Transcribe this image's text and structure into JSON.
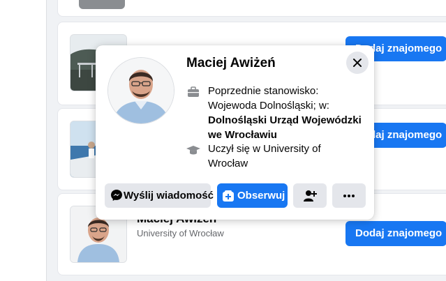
{
  "list": {
    "add_label": "Dodaj znajomego",
    "items": [
      {
        "add_label": "Dodaj znajomego"
      },
      {
        "add_label": "Dodaj znajomego"
      },
      {
        "name": "Maciej Awiżeń",
        "subtitle": "University of Wrocław",
        "add_label": "Dodaj znajomego"
      }
    ]
  },
  "popover": {
    "name": "Maciej Awiżeń",
    "work_prefix": "Poprzednie stanowisko: Wojewoda Dolnośląski; w: ",
    "work_place": "Dolnośląski Urząd Wojewódzki we Wrocławiu",
    "education": "Uczył się w University of Wrocław",
    "actions": {
      "message": "Wyślij wiadomość",
      "follow": "Obserwuj"
    }
  },
  "colors": {
    "accent": "#1877f2",
    "button_gray": "#e4e6eb",
    "background": "#f0f2f5"
  }
}
